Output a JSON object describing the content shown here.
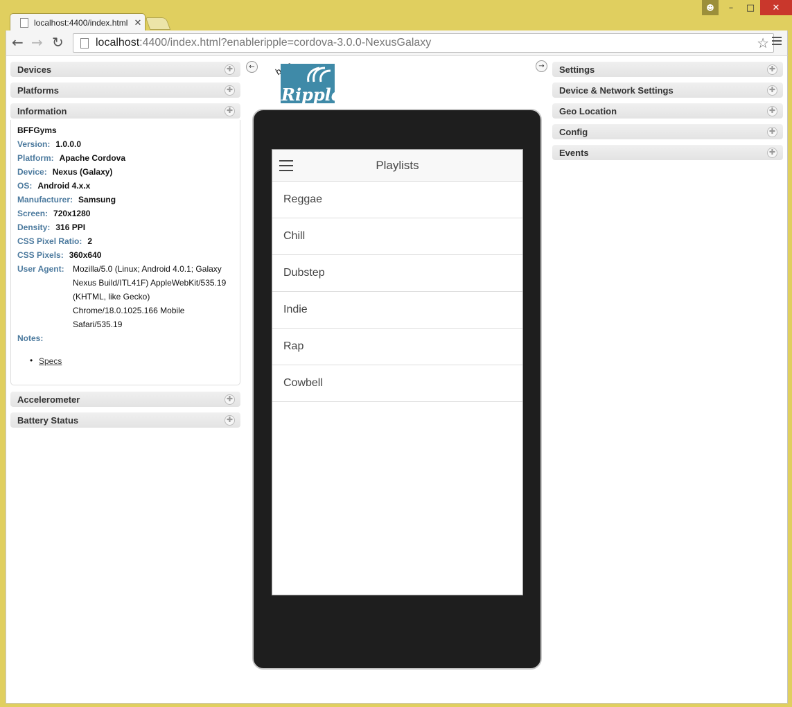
{
  "browser": {
    "tab_title": "localhost:4400/index.html",
    "url_host": "localhost",
    "url_rest": ":4400/index.html?enableripple=cordova-3.0.0-NexusGalaxy"
  },
  "left_panels": {
    "devices": "Devices",
    "platforms": "Platforms",
    "information": "Information",
    "accelerometer": "Accelerometer",
    "battery": "Battery Status"
  },
  "info": {
    "app_name": "BFFGyms",
    "rows": [
      {
        "key": "Version:",
        "value": "1.0.0.0"
      },
      {
        "key": "Platform:",
        "value": "Apache Cordova"
      },
      {
        "key": "Device:",
        "value": "Nexus (Galaxy)"
      },
      {
        "key": "OS:",
        "value": "Android 4.x.x"
      },
      {
        "key": "Manufacturer:",
        "value": "Samsung"
      },
      {
        "key": "Screen:",
        "value": "720x1280"
      },
      {
        "key": "Density:",
        "value": "316 PPI"
      },
      {
        "key": "CSS Pixel Ratio:",
        "value": "2"
      },
      {
        "key": "CSS Pixels:",
        "value": "360x640"
      }
    ],
    "ua_key": "User Agent:",
    "ua_lines": [
      "Mozilla/5.0 (Linux; Android 4.0.1; Galaxy",
      "Nexus Build/ITL41F) AppleWebKit/535.19",
      "(KHTML, like Gecko)",
      "Chrome/18.0.1025.166 Mobile",
      "Safari/535.19"
    ],
    "notes_key": "Notes:",
    "specs_link": "Specs"
  },
  "right_panels": {
    "settings": "Settings",
    "device_network": "Device & Network Settings",
    "geo": "Geo Location",
    "config": "Config",
    "events": "Events"
  },
  "logo": {
    "word": "Ripple",
    "beta": "beta"
  },
  "app": {
    "title": "Playlists",
    "items": [
      "Reggae",
      "Chill",
      "Dubstep",
      "Indie",
      "Rap",
      "Cowbell"
    ]
  }
}
